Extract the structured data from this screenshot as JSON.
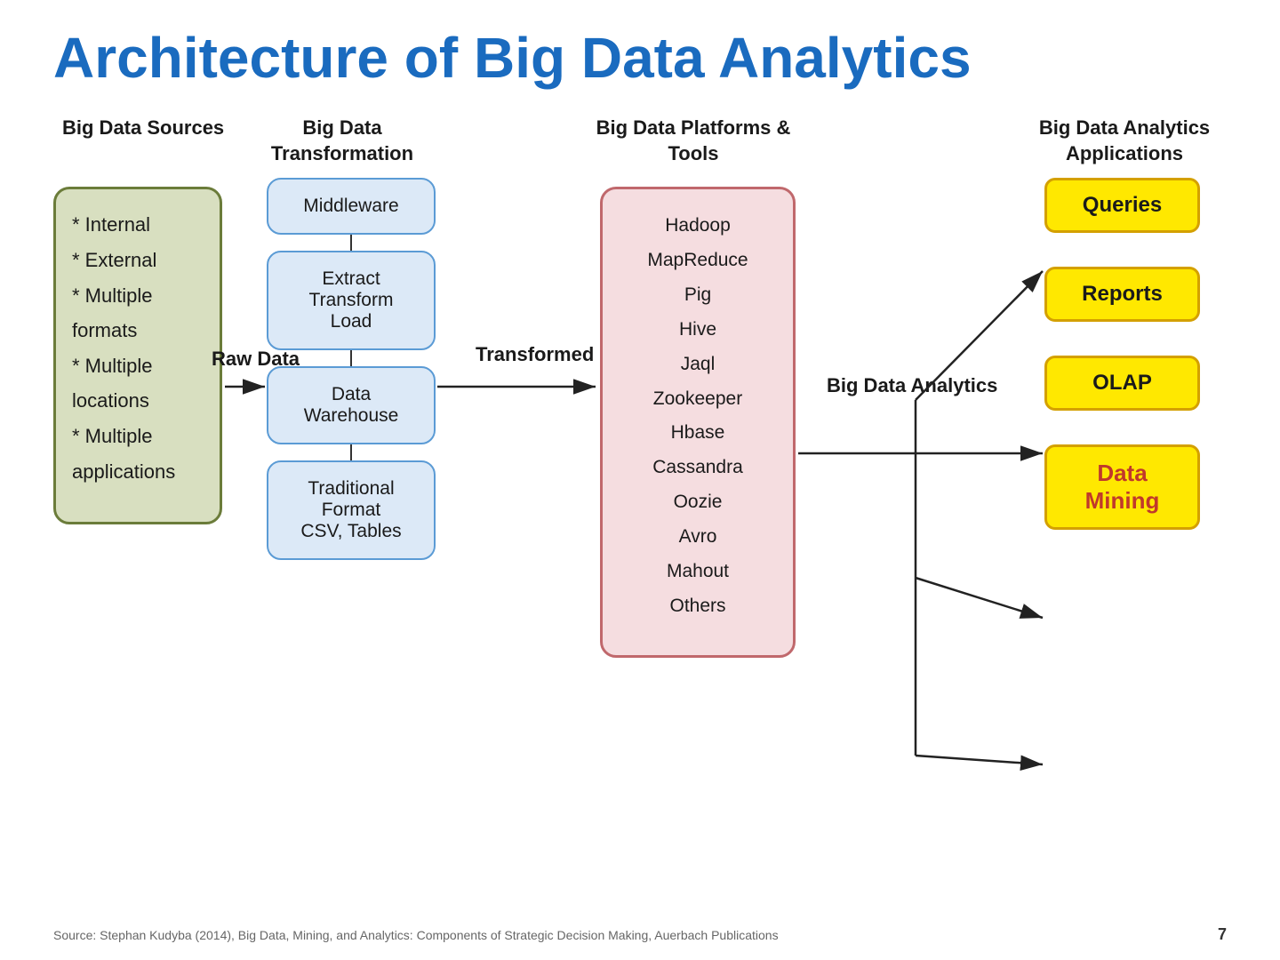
{
  "title": "Architecture of Big Data Analytics",
  "headers": {
    "sources": "Big Data Sources",
    "transform": "Big Data Transformation",
    "platforms": "Big Data Platforms & Tools",
    "analytics": "Big Data Analytics",
    "apps": "Big Data Analytics Applications"
  },
  "sources": {
    "items": [
      "* Internal",
      "* External",
      "* Multiple formats",
      "* Multiple locations",
      "* Multiple applications"
    ]
  },
  "transform": {
    "middleware": "Middleware",
    "etl": "Extract\nTransform\nLoad",
    "warehouse": "Data\nWarehouse",
    "traditional": "Traditional\nFormat\nCSV, Tables",
    "rawData": "Raw\nData",
    "transformedData": "Transformed\nData"
  },
  "platforms": {
    "items": [
      "Hadoop",
      "MapReduce",
      "Pig",
      "Hive",
      "Jaql",
      "Zookeeper",
      "Hbase",
      "Cassandra",
      "Oozie",
      "Avro",
      "Mahout",
      "Others"
    ]
  },
  "apps": {
    "queries": "Queries",
    "reports": "Reports",
    "olap": "OLAP",
    "dataMining": "Data\nMining"
  },
  "footer": {
    "source": "Source: Stephan Kudyba (2014), Big Data, Mining, and Analytics: Components of Strategic Decision Making, Auerbach Publications",
    "page": "7"
  }
}
